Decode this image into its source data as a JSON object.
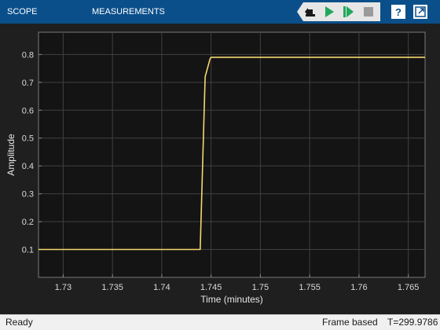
{
  "toolbar": {
    "tabs": [
      {
        "label": "SCOPE"
      },
      {
        "label": "MEASUREMENTS"
      }
    ],
    "icons": [
      "step-back-icon",
      "run-icon",
      "step-forward-icon",
      "stop-icon",
      "help-icon",
      "undock-icon"
    ],
    "colors": {
      "background": "#0a4f8a",
      "run": "#21a85b",
      "stop": "#9a9a9a"
    }
  },
  "chart_data": {
    "type": "line",
    "xlabel": "Time (minutes)",
    "ylabel": "Amplitude",
    "xlim": [
      1.7275,
      1.7667
    ],
    "ylim": [
      0.0,
      0.88
    ],
    "xticks": [
      1.73,
      1.735,
      1.74,
      1.745,
      1.75,
      1.755,
      1.76,
      1.765
    ],
    "xtick_labels": [
      "1.73",
      "1.735",
      "1.74",
      "1.745",
      "1.75",
      "1.755",
      "1.76",
      "1.765"
    ],
    "yticks": [
      0.1,
      0.2,
      0.3,
      0.4,
      0.5,
      0.6,
      0.7,
      0.8
    ],
    "ytick_labels": [
      "0.1",
      "0.2",
      "0.3",
      "0.4",
      "0.5",
      "0.6",
      "0.7",
      "0.8"
    ],
    "grid": true,
    "series": [
      {
        "color": "#f5d76e",
        "x": [
          1.7275,
          1.7439,
          1.7444,
          1.7449,
          1.745,
          1.7667
        ],
        "y": [
          0.1,
          0.1,
          0.72,
          0.785,
          0.79,
          0.79
        ]
      }
    ],
    "colors": {
      "axes_background": "#141414",
      "figure_background": "#1f1f1f",
      "grid": "#404040",
      "axis_text": "#d9d9d9"
    }
  },
  "statusbar": {
    "ready": "Ready",
    "mode": "Frame based",
    "time": "T=299.9786"
  }
}
